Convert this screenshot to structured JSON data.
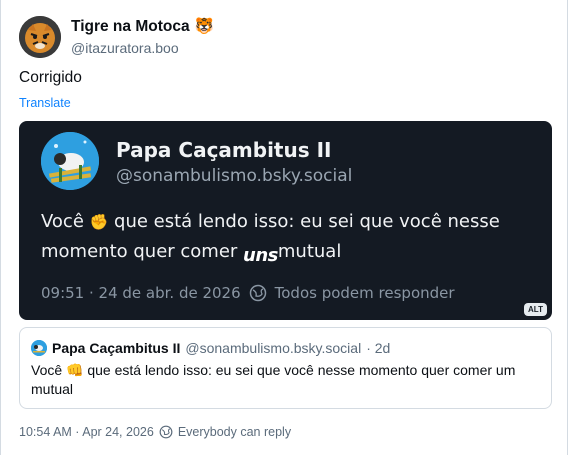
{
  "post": {
    "author_name": "Tigre na Motoca",
    "author_badge_emoji": "🐯",
    "author_handle": "@itazuratora.boo",
    "text": "Corrigido",
    "translate_label": "Translate",
    "timestamp": "10:54 AM · Apr 24, 2026",
    "reply_setting": "Everybody can reply"
  },
  "embedded_image": {
    "name": "Papa Caçambitus II",
    "handle": "@sonambulismo.bsky.social",
    "body_part1": "Você ",
    "body_emoji": "✊",
    "body_part2": " que está lendo isso: eu sei que você nesse momento quer comer ",
    "body_overlay": "uns",
    "body_part3": "mutual",
    "meta_time": "09:51 · 24 de abr. de 2026",
    "meta_reply": "Todos podem responder",
    "alt_label": "ALT"
  },
  "quote": {
    "name": "Papa Caçambitus II",
    "handle": "@sonambulismo.bsky.social",
    "age": "· 2d",
    "text": "Você 👊 que está lendo isso: eu sei que você nesse momento quer comer um mutual"
  },
  "colors": {
    "link": "#1083fe",
    "image_bg": "#141a23",
    "muted": "#5b6b7b"
  }
}
